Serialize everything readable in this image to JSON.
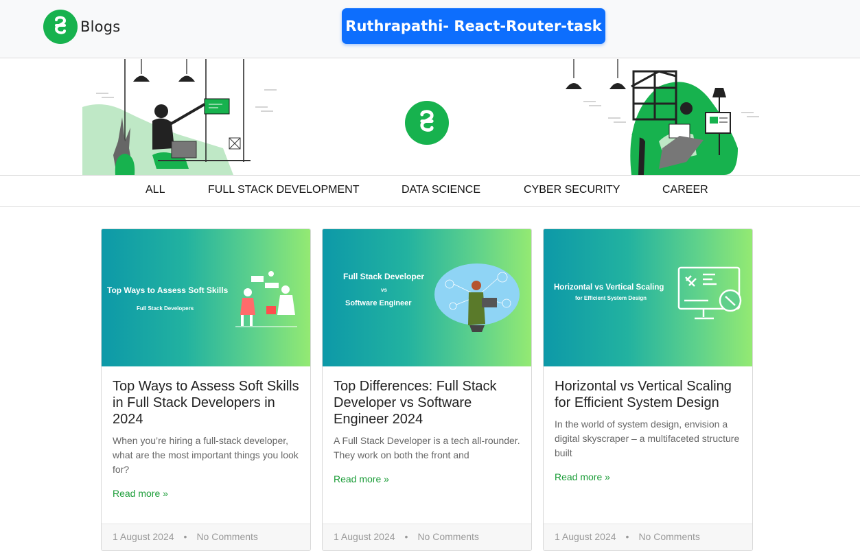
{
  "header": {
    "brand_text": "Blogs",
    "title_button": "Ruthrapathi- React-Router-task"
  },
  "nav": {
    "items": [
      "ALL",
      "FULL STACK DEVELOPMENT",
      "DATA SCIENCE",
      "CYBER SECURITY",
      "CAREER"
    ]
  },
  "colors": {
    "brand_green": "#17b24e",
    "button_blue": "#0d6efd",
    "link_green": "#1a9c37"
  },
  "posts": [
    {
      "image_title": "Top Ways to Assess Soft Skills",
      "image_subtitle": "Full Stack Developers",
      "title": "Top Ways to Assess Soft Skills in Full Stack Developers in 2024",
      "excerpt": "When you’re hiring a full-stack developer, what are the most important things you look for?",
      "read_more": "Read more »",
      "date": "1 August 2024",
      "separator": "•",
      "comments": "No Comments"
    },
    {
      "image_title": "Full Stack Developer",
      "image_vs": "vs",
      "image_subtitle": "Software Engineer",
      "title": "Top Differences: Full Stack Developer vs Software Engineer 2024",
      "excerpt": "A Full Stack Developer is a tech all-rounder. They work on both the front and",
      "read_more": "Read more »",
      "date": "1 August 2024",
      "separator": "•",
      "comments": "No Comments"
    },
    {
      "image_title": "Horizontal vs Vertical Scaling",
      "image_subtitle": "for Efficient System Design",
      "title": "Horizontal vs Vertical Scaling for Efficient System Design",
      "excerpt": "In the world of system design, envision a digital skyscraper – a multifaceted structure built",
      "read_more": "Read more »",
      "date": "1 August 2024",
      "separator": "•",
      "comments": "No Comments"
    }
  ]
}
